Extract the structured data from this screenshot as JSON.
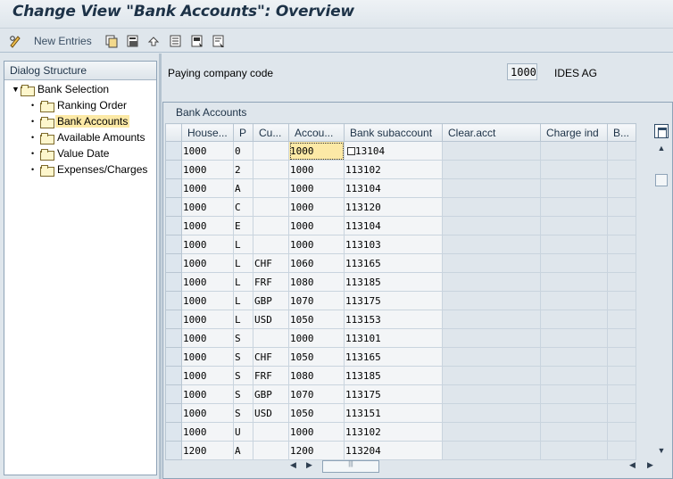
{
  "title": "Change View \"Bank Accounts\": Overview",
  "toolbar": {
    "new_entries_label": "New Entries",
    "icons": [
      "pencil-glasses-icon",
      "copy-icon",
      "save-as-icon",
      "undo-icon",
      "select-all-icon",
      "select-block-icon",
      "deselect-icon"
    ]
  },
  "dialog_structure": {
    "header": "Dialog Structure",
    "root": "Bank Selection",
    "items": [
      "Ranking Order",
      "Bank Accounts",
      "Available Amounts",
      "Value Date",
      "Expenses/Charges"
    ],
    "selected": "Bank Accounts"
  },
  "paying_company": {
    "label": "Paying company code",
    "value": "1000",
    "description": "IDES AG"
  },
  "bank_accounts": {
    "caption": "Bank Accounts",
    "columns": [
      "House...",
      "P",
      "Cu...",
      "Accou...",
      "Bank subaccount",
      "Clear.acct",
      "Charge ind",
      "B..."
    ],
    "rows": [
      [
        "1000",
        "0",
        "",
        "1000",
        "113104",
        "",
        "",
        ""
      ],
      [
        "1000",
        "2",
        "",
        "1000",
        "113102",
        "",
        "",
        ""
      ],
      [
        "1000",
        "A",
        "",
        "1000",
        "113104",
        "",
        "",
        ""
      ],
      [
        "1000",
        "C",
        "",
        "1000",
        "113120",
        "",
        "",
        ""
      ],
      [
        "1000",
        "E",
        "",
        "1000",
        "113104",
        "",
        "",
        ""
      ],
      [
        "1000",
        "L",
        "",
        "1000",
        "113103",
        "",
        "",
        ""
      ],
      [
        "1000",
        "L",
        "CHF",
        "1060",
        "113165",
        "",
        "",
        ""
      ],
      [
        "1000",
        "L",
        "FRF",
        "1080",
        "113185",
        "",
        "",
        ""
      ],
      [
        "1000",
        "L",
        "GBP",
        "1070",
        "113175",
        "",
        "",
        ""
      ],
      [
        "1000",
        "L",
        "USD",
        "1050",
        "113153",
        "",
        "",
        ""
      ],
      [
        "1000",
        "S",
        "",
        "1000",
        "113101",
        "",
        "",
        ""
      ],
      [
        "1000",
        "S",
        "CHF",
        "1050",
        "113165",
        "",
        "",
        ""
      ],
      [
        "1000",
        "S",
        "FRF",
        "1080",
        "113185",
        "",
        "",
        ""
      ],
      [
        "1000",
        "S",
        "GBP",
        "1070",
        "113175",
        "",
        "",
        ""
      ],
      [
        "1000",
        "S",
        "USD",
        "1050",
        "113151",
        "",
        "",
        ""
      ],
      [
        "1000",
        "U",
        "",
        "1000",
        "113102",
        "",
        "",
        ""
      ],
      [
        "1200",
        "A",
        "",
        "1200",
        "113204",
        "",
        "",
        ""
      ]
    ]
  },
  "colors": {
    "title_text": "#1d3247",
    "selection_yellow": "#fce9a6",
    "background": "#dfe6ec"
  }
}
